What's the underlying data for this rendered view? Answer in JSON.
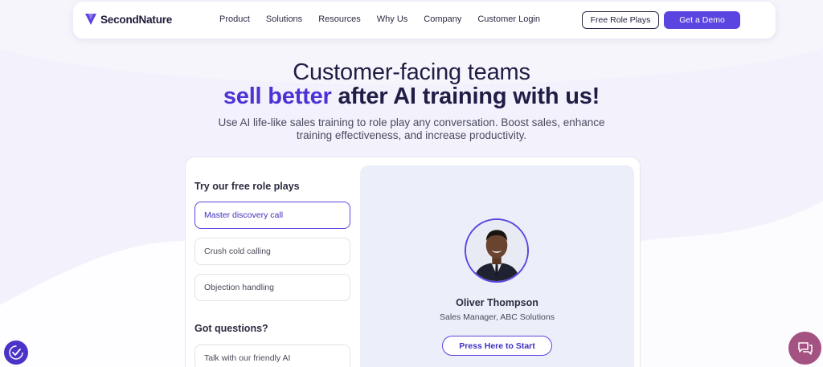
{
  "brand": {
    "name": "SecondNature",
    "accent_color": "#5b45e0",
    "logo_icon": "v-shield-logo-icon"
  },
  "nav": {
    "items": [
      "Product",
      "Solutions",
      "Resources",
      "Why Us",
      "Company",
      "Customer Login"
    ],
    "free_role_plays_label": "Free Role Plays",
    "demo_label": "Get a Demo"
  },
  "hero": {
    "line1": "Customer-facing teams",
    "line2_accent": "sell better",
    "line2_rest": " after AI training with us!",
    "subtitle": "Use AI life-like sales training to role play any conversation. Boost sales, enhance training effectiveness, and increase productivity."
  },
  "roleplay": {
    "section_title": "Try our free role plays",
    "options": [
      {
        "label": "Master discovery call",
        "active": true
      },
      {
        "label": "Crush cold calling",
        "active": false
      },
      {
        "label": "Objection handling",
        "active": false
      }
    ],
    "questions_title": "Got questions?",
    "questions_option": "Talk with our friendly AI"
  },
  "persona": {
    "name": "Oliver Thompson",
    "role": "Sales Manager, ABC Solutions",
    "start_label": "Press Here to Start"
  },
  "widgets": {
    "accessibility_icon": "accessibility-icon",
    "chat_icon": "chat-bubbles-icon",
    "chat_color": "#a35282"
  }
}
